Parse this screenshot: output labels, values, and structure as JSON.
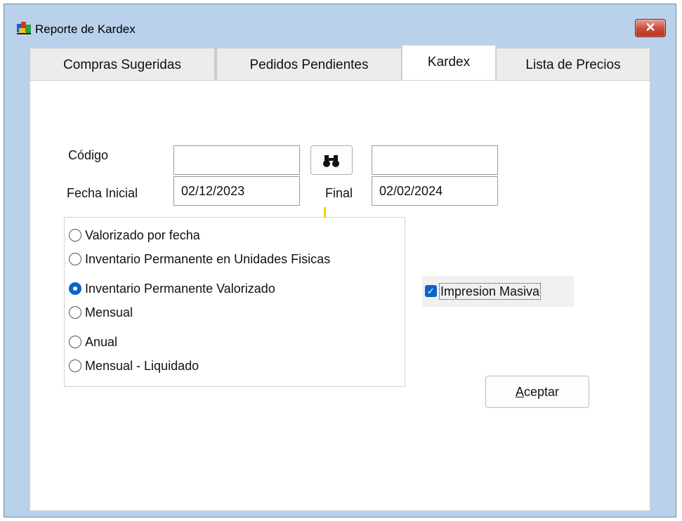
{
  "window": {
    "title": "Reporte de Kardex",
    "close_symbol": "✕",
    "app_icon": "colorful-app-icon",
    "close_color": "#c9513c"
  },
  "tabs": [
    {
      "label": "Compras Sugeridas",
      "active": false
    },
    {
      "label": "Pedidos Pendientes",
      "active": false
    },
    {
      "label": "Kardex",
      "active": true
    },
    {
      "label": "Lista de Precios",
      "active": false
    }
  ],
  "form": {
    "codigo_label": "Código",
    "codigo_value": "",
    "codigo_desc_value": "",
    "find_icon": "binoculars-icon",
    "fecha_inicial_label": "Fecha Inicial",
    "fecha_inicial_value": "02/12/2023",
    "final_label": "Final",
    "final_value": "02/02/2024"
  },
  "options": [
    {
      "label": "Valorizado por fecha",
      "selected": false
    },
    {
      "label": "Inventario Permanente en Unidades Fisicas",
      "selected": false
    },
    {
      "label": "Inventario Permanente Valorizado",
      "selected": true
    },
    {
      "label": "Mensual",
      "selected": false
    },
    {
      "label": "Anual",
      "selected": false
    },
    {
      "label": "Mensual - Liquidado",
      "selected": false
    }
  ],
  "impresion_masiva": {
    "label": "Impresion Masiva",
    "checked": true
  },
  "accept": {
    "access_key": "A",
    "rest": "ceptar"
  },
  "colors": {
    "accent": "#0a64c8",
    "window_bg": "#b9d1ea"
  }
}
